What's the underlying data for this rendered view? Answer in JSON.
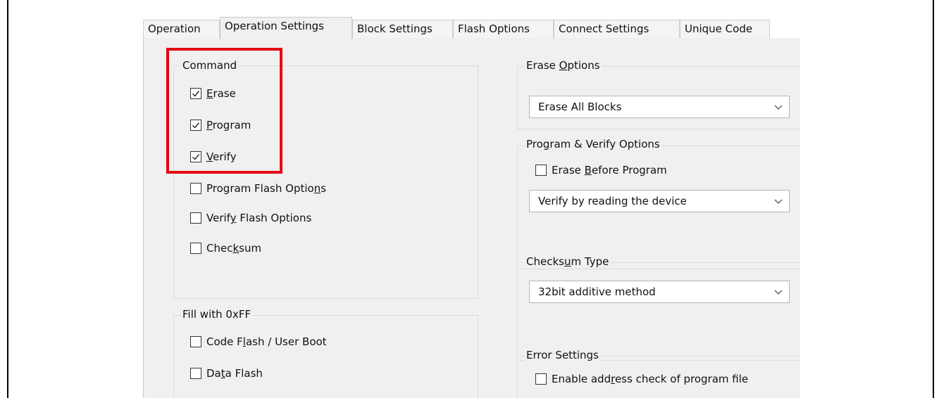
{
  "tabs": [
    {
      "label": "Operation",
      "active": false
    },
    {
      "label": "Operation Settings",
      "active": true
    },
    {
      "label": "Block Settings",
      "active": false
    },
    {
      "label": "Flash Options",
      "active": false
    },
    {
      "label": "Connect Settings",
      "active": false
    },
    {
      "label": "Unique Code",
      "active": false
    }
  ],
  "command": {
    "title": "Command",
    "erase": {
      "label": "Erase",
      "checked": true
    },
    "program": {
      "label": "Program",
      "checked": true
    },
    "verify": {
      "label": "Verify",
      "checked": true
    },
    "program_flash_options": {
      "label": "Program Flash Options",
      "checked": false
    },
    "verify_flash_options": {
      "label": "Verify Flash Options",
      "checked": false
    },
    "checksum": {
      "label": "Checksum",
      "checked": false
    }
  },
  "fill": {
    "title": "Fill with 0xFF",
    "code_flash": {
      "label": "Code Flash / User Boot",
      "checked": false
    },
    "data_flash": {
      "label": "Data Flash",
      "checked": false
    }
  },
  "erase_options": {
    "title": "Erase Options",
    "value": "Erase All Blocks"
  },
  "program_verify": {
    "title": "Program & Verify Options",
    "erase_before": {
      "label": "Erase Before Program",
      "checked": false
    },
    "value": "Verify by reading the device"
  },
  "checksum_type": {
    "title": "Checksum Type",
    "value": "32bit additive method"
  },
  "error_settings": {
    "title": "Error Settings",
    "address_check": {
      "label": "Enable address check of program file",
      "checked": false
    }
  },
  "colors": {
    "highlight": "#e60012",
    "panel": "#f0f0f0"
  }
}
